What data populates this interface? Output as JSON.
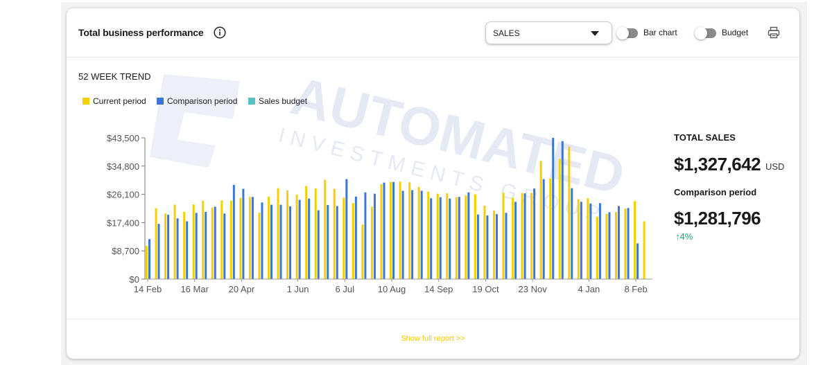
{
  "card": {
    "title": "Total business performance",
    "metric_select": {
      "value": "SALES"
    },
    "toggles": [
      {
        "label": "Bar chart",
        "on": false
      },
      {
        "label": "Budget",
        "on": false
      }
    ]
  },
  "trend_title": "52 WEEK TREND",
  "legend": [
    {
      "label": "Current period",
      "color": "#f5d000"
    },
    {
      "label": "Comparison period",
      "color": "#3a78d8"
    },
    {
      "label": "Sales budget",
      "color": "#56c2c4"
    }
  ],
  "totals": {
    "label": "TOTAL SALES",
    "value": "$1,327,642",
    "currency": "USD",
    "comparison_label": "Comparison period",
    "comparison_value": "$1,281,796",
    "change": "↑4%"
  },
  "footer": {
    "link": "Show full report >>"
  },
  "watermark": {
    "line1": "AUTOMATED",
    "line2": "INVESTMENTS GROUP"
  },
  "chart_data": {
    "type": "bar",
    "ylim": [
      0,
      43500
    ],
    "yticks": [
      0,
      8700,
      17400,
      26100,
      34800,
      43500
    ],
    "ytick_labels": [
      "$0",
      "$8,700",
      "$17,400",
      "$26,100",
      "$34,800",
      "$43,500"
    ],
    "xtick_labels": [
      "14 Feb",
      "16 Mar",
      "20 Apr",
      "1 Jun",
      "6 Jul",
      "10 Aug",
      "14 Sep",
      "19 Oct",
      "23 Nov",
      "4 Jan",
      "8 Feb"
    ],
    "xtick_index": [
      0,
      5,
      10,
      16,
      21,
      26,
      31,
      36,
      41,
      47,
      52
    ],
    "series": [
      {
        "name": "Current period",
        "color": "#f5d000",
        "values": [
          10200,
          21800,
          20200,
          22900,
          20700,
          23000,
          24100,
          22000,
          24200,
          24200,
          25000,
          25300,
          20500,
          25400,
          28000,
          27300,
          26000,
          28700,
          27900,
          30600,
          27800,
          25100,
          23400,
          16800,
          22300,
          29200,
          29900,
          30000,
          29800,
          28400,
          26900,
          26300,
          26400,
          25200,
          25800,
          26100,
          22600,
          21100,
          26600,
          25000,
          26500,
          26600,
          36400,
          31000,
          37000,
          40800,
          24600,
          24900,
          19200,
          20100,
          20700,
          21700,
          24000,
          17800
        ]
      },
      {
        "name": "Comparison period",
        "color": "#3a78d8",
        "values": [
          12300,
          17000,
          19800,
          18700,
          17800,
          20400,
          20700,
          22300,
          20200,
          29000,
          27800,
          25300,
          23600,
          22900,
          22900,
          22400,
          24400,
          24800,
          21200,
          22800,
          22500,
          30800,
          25400,
          26700,
          26300,
          29700,
          29900,
          27200,
          27400,
          27200,
          24900,
          25200,
          24800,
          25300,
          26700,
          19900,
          19600,
          20000,
          20400,
          23800,
          26400,
          27900,
          30800,
          43500,
          42500,
          28000,
          23800,
          23300,
          23400,
          20600,
          22500,
          21900,
          11000
        ]
      }
    ]
  }
}
